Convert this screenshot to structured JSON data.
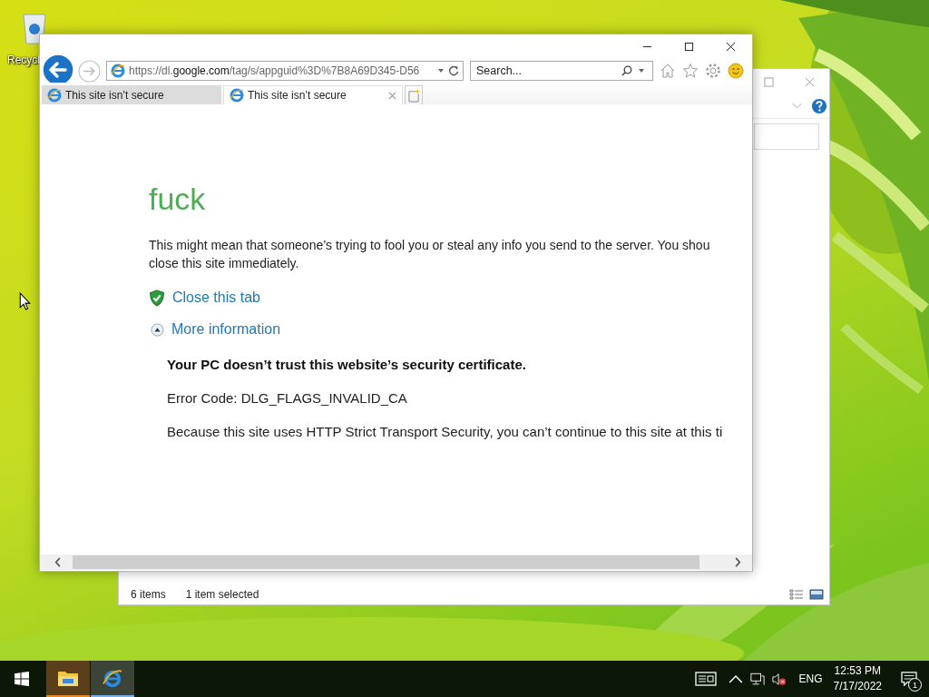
{
  "desktop": {
    "icons": [
      {
        "label": "Recycl"
      }
    ]
  },
  "explorer_window": {
    "status_bar": {
      "item_count": "6 items",
      "selection": "1 item selected"
    }
  },
  "browser": {
    "address": "https://dl.**google.com**/tag/s/appguid%3D%7B8A69D345-D56",
    "search": {
      "placeholder": "Search..."
    },
    "tabs": [
      {
        "title": "This site isn’t secure",
        "selected": false
      },
      {
        "title": "This site isn’t secure",
        "selected": true
      }
    ],
    "page": {
      "heading": "fuck",
      "paragraph_lines": [
        "This might mean that someone’s trying to fool you or steal any info you send to the server. You shou",
        "close this site immediately."
      ],
      "actions": [
        {
          "kind": "close",
          "label": "Close this tab"
        },
        {
          "kind": "toggle",
          "label": "More information",
          "expanded": true
        }
      ],
      "details": {
        "title": "Your PC doesn’t trust this website’s security certificate.",
        "error_code": "Error Code: DLG_FLAGS_INVALID_CA",
        "explanation": "Because this site uses HTTP Strict Transport Security, you can’t continue to this site at this ti"
      }
    }
  },
  "taskbar": {
    "apps": [
      {
        "kind": "explorer"
      },
      {
        "kind": "browser"
      }
    ],
    "language": "ENG",
    "time": "12:53 PM",
    "date": "7/17/2022",
    "notifications": "1"
  }
}
